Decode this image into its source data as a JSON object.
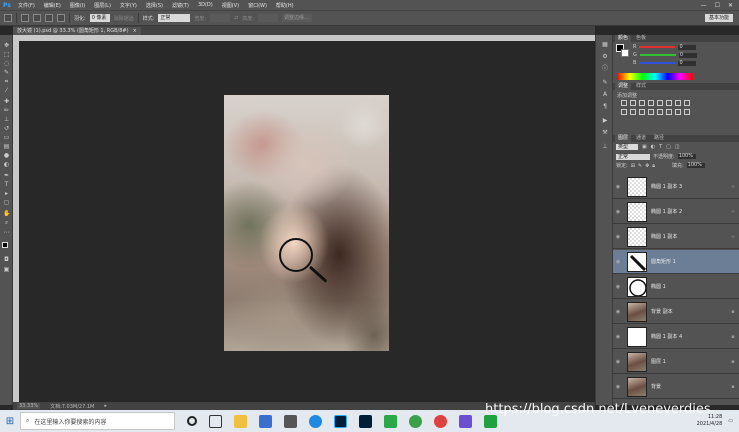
{
  "app": {
    "logo": "Ps"
  },
  "menubar": {
    "items": [
      "文件(F)",
      "编辑(E)",
      "图像(I)",
      "图层(L)",
      "文字(Y)",
      "选择(S)",
      "滤镜(T)",
      "3D(D)",
      "视图(V)",
      "窗口(W)",
      "帮助(H)"
    ],
    "window_controls": [
      "—",
      "☐",
      "✕"
    ]
  },
  "options_bar": {
    "feather_label": "羽化:",
    "feather_value": "0 像素",
    "antialias_label": "消除锯齿",
    "style_label": "样式:",
    "style_value": "正常",
    "width_label": "宽度:",
    "height_label": "高度:",
    "refine_edge_label": "调整边缘...",
    "workspace": "基本功能"
  },
  "document": {
    "tab_title": "放大镜 (1).psd @ 33.3% (圆角矩形 1, RGB/8#)",
    "tab_close": "×",
    "zoom": "33.33%",
    "doc_info": "文档:7.03M/27.1M"
  },
  "colors": {
    "accent": "#31a8ff",
    "selected_layer": "#6b7e96",
    "panel_bg": "#535353",
    "canvas_bg": "#282828"
  },
  "color_panel": {
    "tabs": [
      "颜色",
      "色板"
    ],
    "rows": [
      {
        "label": "R",
        "value": "0",
        "color": "#e03030"
      },
      {
        "label": "G",
        "value": "0",
        "color": "#30c030"
      },
      {
        "label": "B",
        "value": "0",
        "color": "#3050e0"
      }
    ]
  },
  "adjust_panel": {
    "tabs": [
      "调整",
      "样式"
    ],
    "title": "添加调整"
  },
  "layers_panel": {
    "tabs": [
      "图层",
      "通道",
      "路径"
    ],
    "kind_label": "类型",
    "blend_mode": "正常",
    "opacity_label": "不透明度:",
    "opacity_value": "100%",
    "lock_label": "锁定:",
    "fill_label": "填充:",
    "fill_value": "100%",
    "layers": [
      {
        "name": "椭圆 1 副本 3",
        "thumb": "checker",
        "selected": false
      },
      {
        "name": "椭圆 1 副本 2",
        "thumb": "checker",
        "selected": false
      },
      {
        "name": "椭圆 1 副本",
        "thumb": "checker",
        "selected": false
      },
      {
        "name": "圆角矩形 1",
        "thumb": "handle",
        "selected": true
      },
      {
        "name": "椭圆 1",
        "thumb": "circle",
        "selected": false
      },
      {
        "name": "背景 副本",
        "thumb": "photo",
        "selected": false
      },
      {
        "name": "椭圆 1 副本 4",
        "thumb": "white",
        "selected": false
      },
      {
        "name": "图层 1",
        "thumb": "photo",
        "selected": false
      },
      {
        "name": "背景",
        "thumb": "photo",
        "selected": false
      }
    ]
  },
  "taskbar": {
    "search_placeholder": "在这里输入你要搜索的内容",
    "time": "11:28",
    "date": "2021/4/28"
  },
  "watermark": "https://blog.csdn.net/Lveneverdies"
}
